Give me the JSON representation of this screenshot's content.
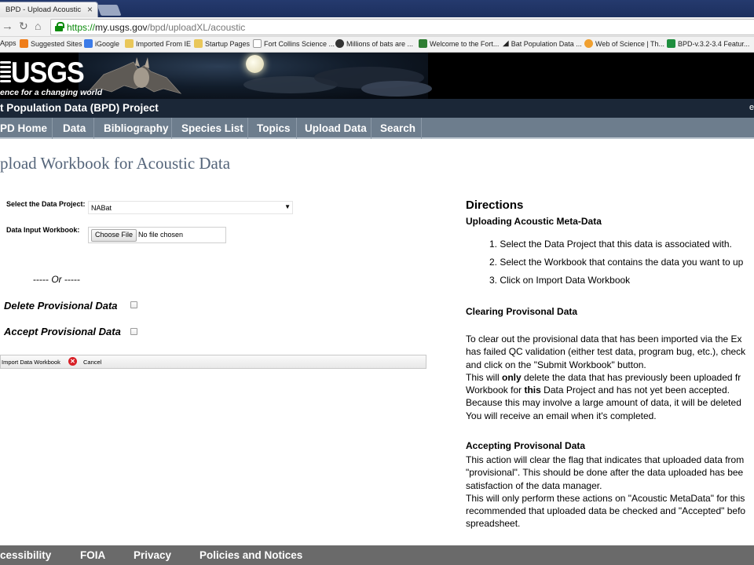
{
  "browser": {
    "tab_title": "BPD - Upload Acoustic Da",
    "tab_close": "×",
    "url_scheme": "https://",
    "url_host": "my.usgs.gov",
    "url_path": "/bpd/uploadXL/acoustic",
    "bookmarks": [
      "Apps",
      "Suggested Sites",
      "iGoogle",
      "Imported From IE",
      "Startup Pages",
      "Fort Collins Science ...",
      "Millions of bats are ...",
      "Welcome to the Fort...",
      "Bat Population Data ...",
      "Web of Science | Th...",
      "BPD-v.3.2-3.4 Featur..."
    ]
  },
  "banner": {
    "logo": "USGS",
    "tagline": "ence for a changing world"
  },
  "title_strip": {
    "title": "t Population Data (BPD) Project",
    "right_fragment": "e"
  },
  "nav": {
    "items": [
      "PD Home",
      "Data",
      "Bibliography",
      "Species List",
      "Topics",
      "Upload Data",
      "Search"
    ]
  },
  "page": {
    "heading": "pload Workbook for Acoustic Data"
  },
  "form": {
    "project_label": "Select the Data Project:",
    "project_value": "NABat",
    "workbook_label": "Data Input Workbook:",
    "choose_file": "Choose File",
    "no_file": "No file chosen",
    "or_left": "----- ",
    "or_word": "Or",
    "or_right": " -----",
    "delete_label": "Delete Provisional Data",
    "accept_label": "Accept Provisional Data",
    "import_button": "Import Data Workbook",
    "cancel_button": "Cancel"
  },
  "directions": {
    "heading": "Directions",
    "upload_heading": "Uploading Acoustic Meta-Data",
    "steps": [
      "1. Select the Data Project that this data is associated with.",
      "2. Select the Workbook that contains the data you want to up",
      "3. Click on Import Data Workbook"
    ],
    "clear_heading": "Clearing Provisonal Data",
    "clear_lines": [
      "To clear out the provisional data that has been imported via the Ex",
      "has failed QC validation (either test data, program bug, etc.), check",
      "and click on the \"Submit Workbook\" button."
    ],
    "only_line_pre": "This will ",
    "only_line_bold": "only",
    "only_line_post": " delete the data that has previously been uploaded fr",
    "this_line_pre": "Workbook for ",
    "this_line_bold": "this",
    "this_line_post": " Data Project and has not yet been accepted.",
    "clear_lines_2": [
      "Because this may involve a large amount of data, it will be deleted",
      "You will receive an email when it's completed."
    ],
    "accept_heading": "Accepting Provisonal Data",
    "accept_lines": [
      "This action will clear the flag that indicates that uploaded data from",
      "\"provisional\". This should be done after the data uploaded has bee",
      "satisfaction of the data manager.",
      "This will only perform these actions on \"Acoustic MetaData\" for this",
      "recommended that uploaded data be checked and \"Accepted\" befo",
      "spreadsheet."
    ]
  },
  "footer": {
    "links": [
      "cessibility",
      "FOIA",
      "Privacy",
      "Policies and Notices"
    ]
  }
}
